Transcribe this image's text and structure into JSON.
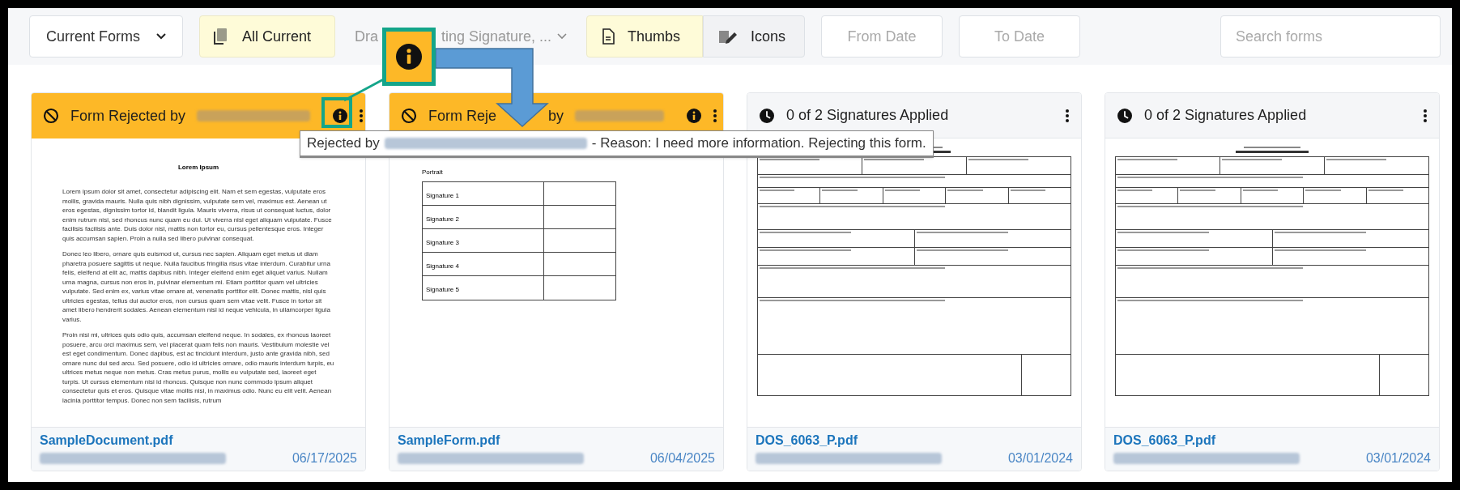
{
  "toolbar": {
    "view_select": {
      "value": "Current Forms"
    },
    "filter_buttons": [
      {
        "label": "All Current",
        "selected": true
      }
    ],
    "status_filter": {
      "visible_parts": [
        "Dra",
        "ting Signature, ..."
      ]
    },
    "view_toggle": [
      {
        "label": "Thumbs",
        "selected": true,
        "kind": "document"
      },
      {
        "label": "Icons",
        "selected": false,
        "kind": "signature"
      }
    ],
    "date_fields": [
      {
        "placeholder": "From Date"
      },
      {
        "placeholder": "To Date"
      }
    ],
    "search": {
      "placeholder": "Search forms"
    }
  },
  "cards": [
    {
      "kind": "rejected",
      "header_parts": [
        "Form Rejected by"
      ],
      "preview": {
        "kind": "text"
      },
      "filename": "SampleDocument.pdf",
      "date": "06/17/2025"
    },
    {
      "kind": "rejected",
      "header_parts": [
        "Form Reje",
        "by"
      ],
      "preview": {
        "kind": "signatures"
      },
      "filename": "SampleForm.pdf",
      "date": "06/04/2025"
    },
    {
      "kind": "pending",
      "header_parts": [
        "0 of 2 Signatures Applied"
      ],
      "preview": {
        "kind": "form"
      },
      "filename": "DOS_6063_P.pdf",
      "date": "03/01/2024"
    },
    {
      "kind": "pending",
      "header_parts": [
        "0 of 2 Signatures Applied"
      ],
      "preview": {
        "kind": "form"
      },
      "filename": "DOS_6063_P.pdf",
      "date": "03/01/2024"
    }
  ],
  "tooltip": {
    "prefix": "Rejected by",
    "reason": "- Reason: I need more information. Rejecting this form."
  },
  "text_preview": {
    "title": "Lorem Ipsum",
    "paragraphs": [
      "Lorem ipsum dolor sit amet, consectetur adipiscing elit. Nam et sem egestas, vulputate eros mollis, gravida mauris. Nulla quis nibh dignissim, vulputate sem vel, maximus est. Aenean ut eros egestas, dignissim tortor id, blandit ligula. Mauris viverra, risus ut consequat luctus, dolor enim rutrum nisi, sed rhoncus nunc quam eu dui. Ut viverra nisl eget aliquam vulputate. Fusce facilisis facilisis ante. Duis dolor nisl, mattis non tortor eu, cursus pellentesque eros. Integer quis accumsan sapien. Proin a nulla sed libero pulvinar consequat.",
      "Donec leo libero, ornare quis euismod ut, cursus nec sapien. Aliquam eget metus ut diam pharetra posuere sagittis ut neque. Nulla faucibus fringilla risus vitae interdum. Curabitur urna felis, eleifend at elit ac, mattis dapibus nibh. Integer eleifend enim eget aliquet varius. Nullam urna magna, cursus non eros in, pulvinar elementum mi. Etiam porttitor quam vel ultricies vulputate. Sed enim ex, varius vitae ornare at, venenatis porttitor elit. Donec mattis, nisl quis ultricies egestas, tellus dui auctor eros, non cursus quam sem vitae velit. Fusce in tortor sit amet libero hendrerit sodales. Aenean elementum nisl id neque vehicula, in ullamcorper ligula varius.",
      "Proin nisi mi, ultrices quis odio quis, accumsan eleifend neque. In sodales, ex rhoncus laoreet posuere, arcu orci maximus sem, vel placerat quam felis non mauris. Vestibulum molestie vel est eget condimentum. Donec dapibus, est ac tincidunt interdum, justo ante gravida nibh, sed ornare nunc dui sed arcu. Sed posuere, odio id ultricies ornare, odio mauris interdum turpis, eu ultrices metus neque non metus. Cras metus purus, mollis eu vulputate sed, laoreet eget turpis. Ut cursus elementum nisi id rhoncus. Quisque non nunc commodo ipsum aliquet consectetur quis et eros. Quisque vitae mollis nisi, in maximus odio. Nunc eu elit velit. Aenean lacinia porttitor tempus. Donec non sem facilisis, rutrum"
    ]
  },
  "signature_preview": {
    "title": "Portrait",
    "rows": [
      "Signature 1",
      "Signature 2",
      "Signature 3",
      "Signature 4",
      "Signature 5"
    ]
  }
}
